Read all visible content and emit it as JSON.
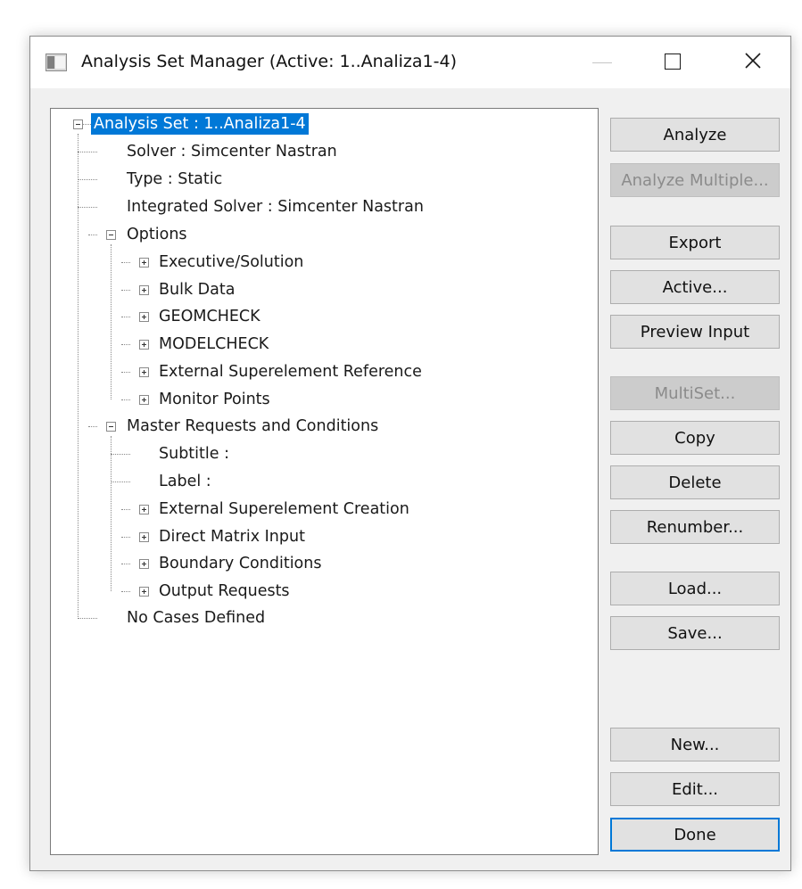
{
  "window": {
    "title": "Analysis Set Manager (Active: 1..Analiza1-4)",
    "icon": "app-window-icon",
    "controls": {
      "minimize": "minimize-icon",
      "maximize": "maximize-icon",
      "close": "close-icon"
    }
  },
  "tree": {
    "root": "Analysis Set : 1..Analiza1-4",
    "solver": "Solver : Simcenter Nastran",
    "type": "Type : Static",
    "integrated_solver": "Integrated Solver : Simcenter Nastran",
    "options": {
      "label": "Options",
      "children": [
        "Executive/Solution",
        "Bulk Data",
        "GEOMCHECK",
        "MODELCHECK",
        "External Superelement Reference",
        "Monitor Points"
      ]
    },
    "master": {
      "label": "Master Requests and Conditions",
      "children": [
        "Subtitle :",
        "Label :",
        "External Superelement Creation",
        "Direct Matrix Input",
        "Boundary Conditions",
        "Output Requests"
      ]
    },
    "no_cases": "No Cases Defined"
  },
  "buttons": {
    "analyze": "Analyze",
    "analyze_multiple": "Analyze Multiple...",
    "export": "Export",
    "active": "Active...",
    "preview_input": "Preview Input",
    "multiset": "MultiSet...",
    "copy": "Copy",
    "delete": "Delete",
    "renumber": "Renumber...",
    "load": "Load...",
    "save": "Save...",
    "new": "New...",
    "edit": "Edit...",
    "done": "Done"
  },
  "colors": {
    "selection": "#0078d7",
    "window_bg": "#f0f0f0",
    "button_bg": "#e1e1e1",
    "disabled_text": "#8b8b8b"
  }
}
